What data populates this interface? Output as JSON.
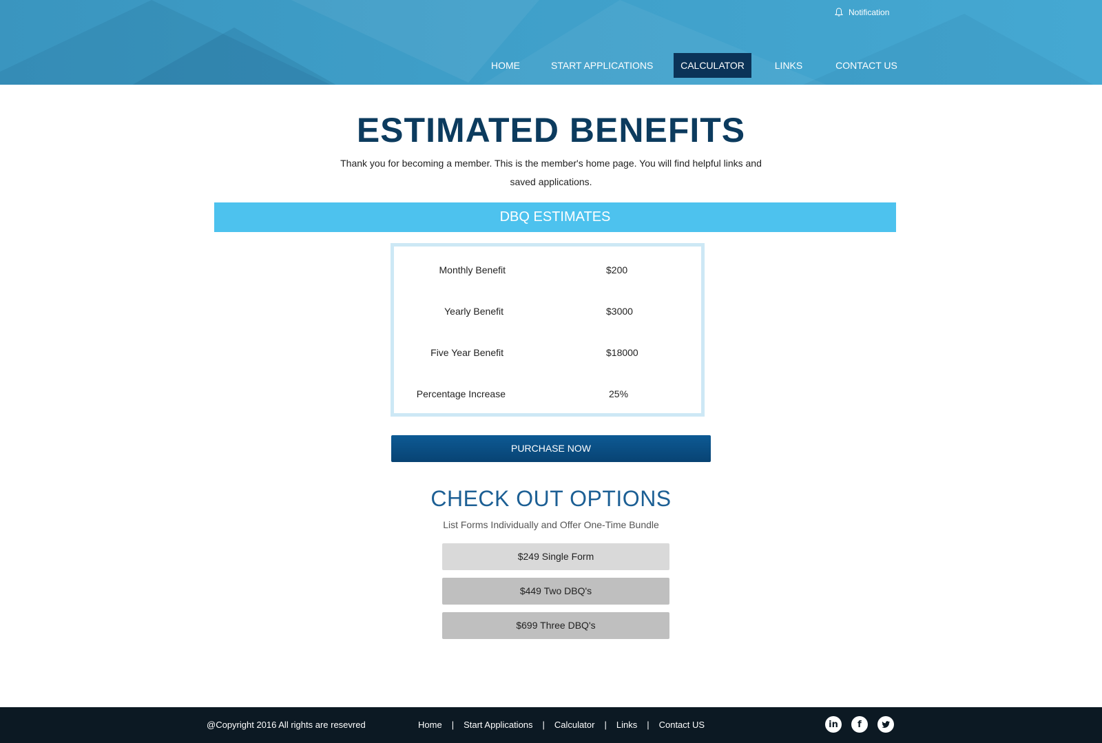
{
  "header": {
    "notification_label": "Notification",
    "nav": [
      {
        "label": "HOME"
      },
      {
        "label": "START APPLICATIONS"
      },
      {
        "label": "CALCULATOR",
        "active": true
      },
      {
        "label": "LINKS"
      },
      {
        "label": "CONTACT US"
      }
    ]
  },
  "main": {
    "title": "ESTIMATED BENEFITS",
    "intro": "Thank you for becoming a member. This is the member's home page. You will find helpful links and saved applications.",
    "band_label": "DBQ ESTIMATES",
    "estimates": [
      {
        "label": "Monthly Benefit",
        "value": "$200"
      },
      {
        "label": "Yearly Benefit",
        "value": "$3000"
      },
      {
        "label": "Five Year Benefit",
        "value": "$18000"
      },
      {
        "label": "Percentage Increase",
        "value": "25%"
      }
    ],
    "purchase_label": "PURCHASE NOW",
    "checkout_title": "CHECK OUT OPTIONS",
    "checkout_subtitle": "List Forms Individually and Offer One-Time Bundle",
    "options": [
      {
        "label": "$249 Single Form"
      },
      {
        "label": "$449 Two DBQ's"
      },
      {
        "label": "$699 Three DBQ's"
      }
    ]
  },
  "footer": {
    "copyright": "@Copyright 2016 All rights are resevred",
    "links": [
      "Home",
      "Start Applications",
      "Calculator",
      "Links",
      "Contact US"
    ],
    "separator": "|",
    "social": [
      "linkedin-icon",
      "facebook-icon",
      "twitter-icon"
    ]
  },
  "colors": {
    "header_blue": "#3f9fc9",
    "nav_active": "#0b3358",
    "title_navy": "#0c3b5e",
    "band_blue": "#4dc2ee",
    "purchase_navy": "#0d5a94",
    "footer_dark": "#0c1923"
  }
}
